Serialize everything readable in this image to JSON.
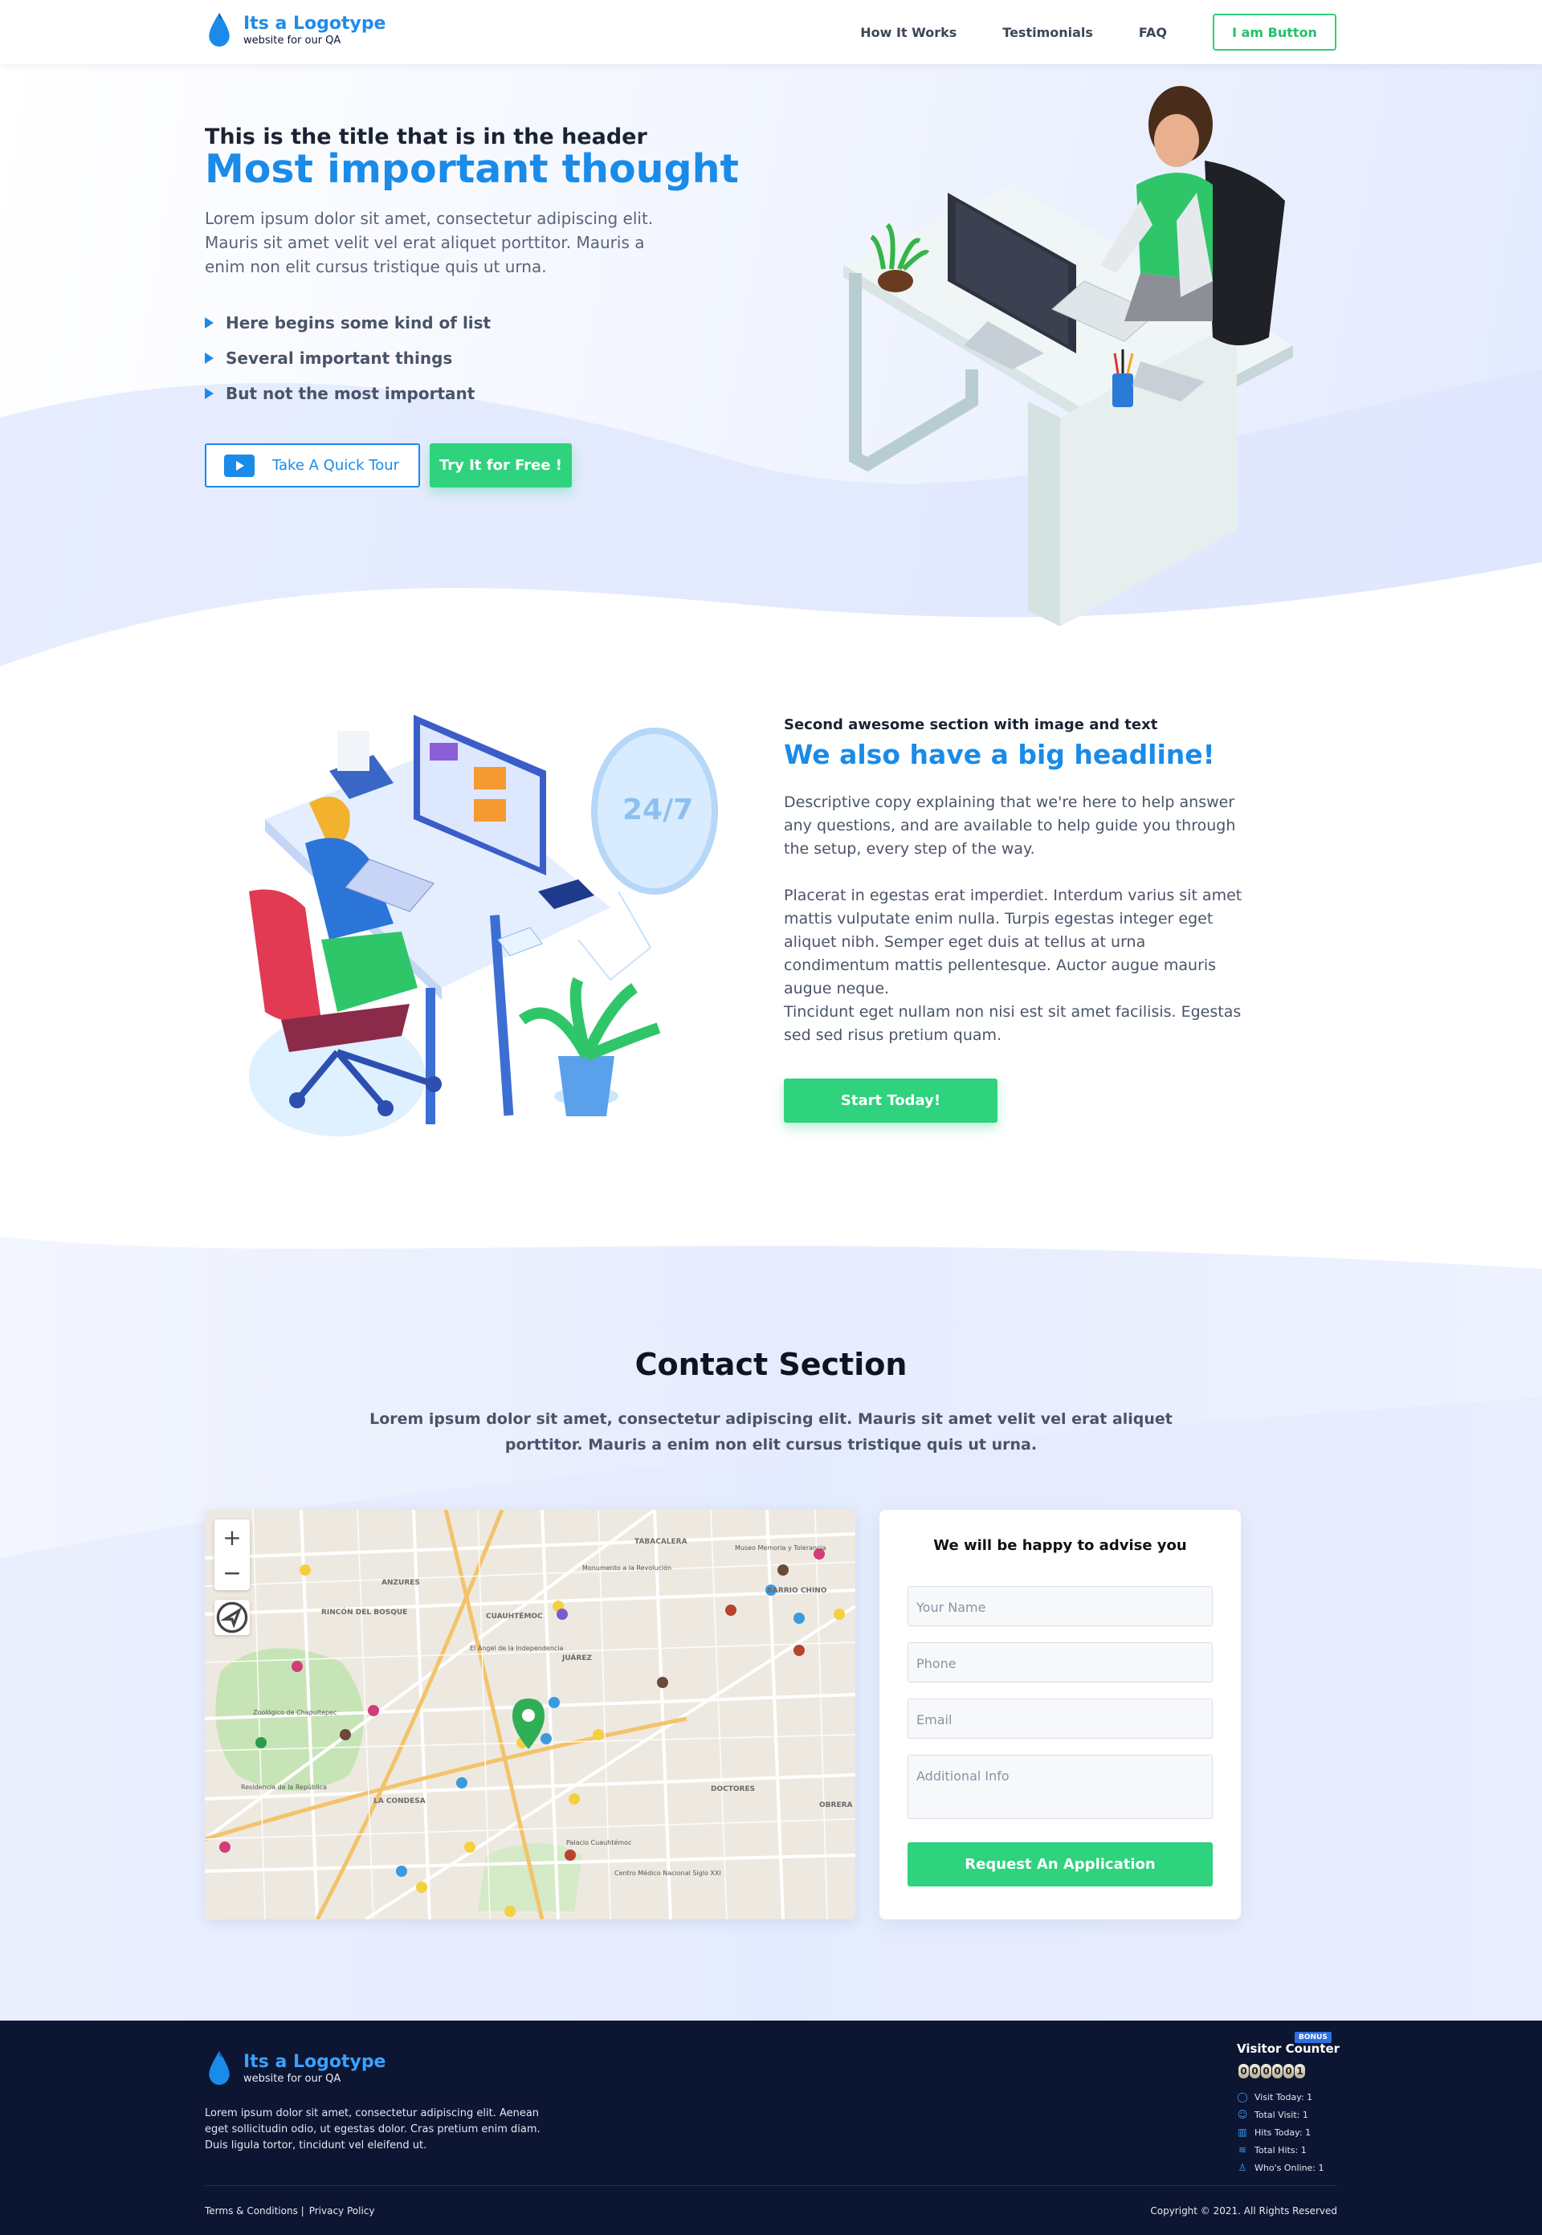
{
  "nav": {
    "logo_name": "Its a Logotype",
    "logo_sub": "website for our QA",
    "links": [
      "How It Works",
      "Testimonials",
      "FAQ"
    ],
    "button": "I am Button"
  },
  "hero": {
    "title_small": "This is the title that is in the header",
    "title_big": "Most important thought",
    "description": "Lorem ipsum dolor sit amet, consectetur adipiscing elit. Mauris sit amet velit vel erat aliquet porttitor. Mauris a enim non elit cursus tristique quis ut urna.",
    "list": [
      "Here begins some kind of list",
      "Several important things",
      "But not the most important"
    ],
    "tour_button": "Take A Quick Tour",
    "try_button": "Try It for Free !"
  },
  "section2": {
    "kicker": "Second awesome section with image and text",
    "headline": "We also have a big headline!",
    "paragraphs": [
      "Descriptive copy explaining that we're here to help answer any questions, and are available to help guide you through the setup, every step of the way.",
      "Placerat in egestas erat imperdiet. Interdum varius sit amet mattis vulputate enim nulla. Turpis egestas integer eget aliquet nibh. Semper eget duis at tellus at urna condimentum mattis pellentesque. Auctor augue mauris augue neque.",
      "Tincidunt eget nullam non nisi est sit amet facilisis. Egestas sed sed risus pretium quam."
    ],
    "button": "Start Today!",
    "badge_247": "24/7"
  },
  "contact": {
    "title": "Contact Section",
    "description": "Lorem ipsum dolor sit amet, consectetur adipiscing elit. Mauris sit amet velit vel erat aliquet porttitor. Mauris a enim non elit cursus tristique quis ut urna.",
    "map_zoom_in": "+",
    "map_zoom_out": "−",
    "map_labels": [
      "TABACALERA",
      "ANZURES",
      "CUAUHTÉMOC",
      "JUÁREZ",
      "BARRIO CHINO",
      "DOCTORES",
      "LA CONDESA",
      "RINCÓN DEL BOSQUE",
      "OBRERA",
      "Monumento a la Revolución",
      "Museo Memoria y Tolerancia",
      "El Ángel de la Independencia",
      "Zoológico de Chapultepec",
      "Palacio Cuauhtémoc",
      "Centro Médico Nacional Siglo XXI",
      "Residencia de la República"
    ],
    "form": {
      "title": "We will be happy to advise you",
      "name_placeholder": "Your Name",
      "phone_placeholder": "Phone",
      "email_placeholder": "Email",
      "info_placeholder": "Additional Info",
      "submit": "Request An Application"
    }
  },
  "footer": {
    "logo_name": "Its a Logotype",
    "logo_sub": "website for our QA",
    "description": "Lorem ipsum dolor sit amet, consectetur adipiscing elit. Aenean eget sollicitudin odio, ut egestas dolor. Cras pretium enim diam. Duis ligula tortor, tincidunt vel eleifend ut.",
    "terms": "Terms & Conditions |",
    "privacy": "Privacy Policy",
    "copyright": "Copyright © 2021.  All Rights Reserved",
    "visitor_counter": {
      "badge": "BONUS",
      "title": "Visitor Counter",
      "digits": [
        "0",
        "0",
        "0",
        "0",
        "0",
        "1"
      ],
      "rows": [
        "Visit Today: 1",
        "Total Visit: 1",
        "Hits Today: 1",
        "Total Hits: 1",
        "Who's Online: 1"
      ]
    }
  },
  "colors": {
    "brand_blue": "#1a8be8",
    "brand_green": "#2fd27d",
    "footer_bg": "#0c1632"
  }
}
